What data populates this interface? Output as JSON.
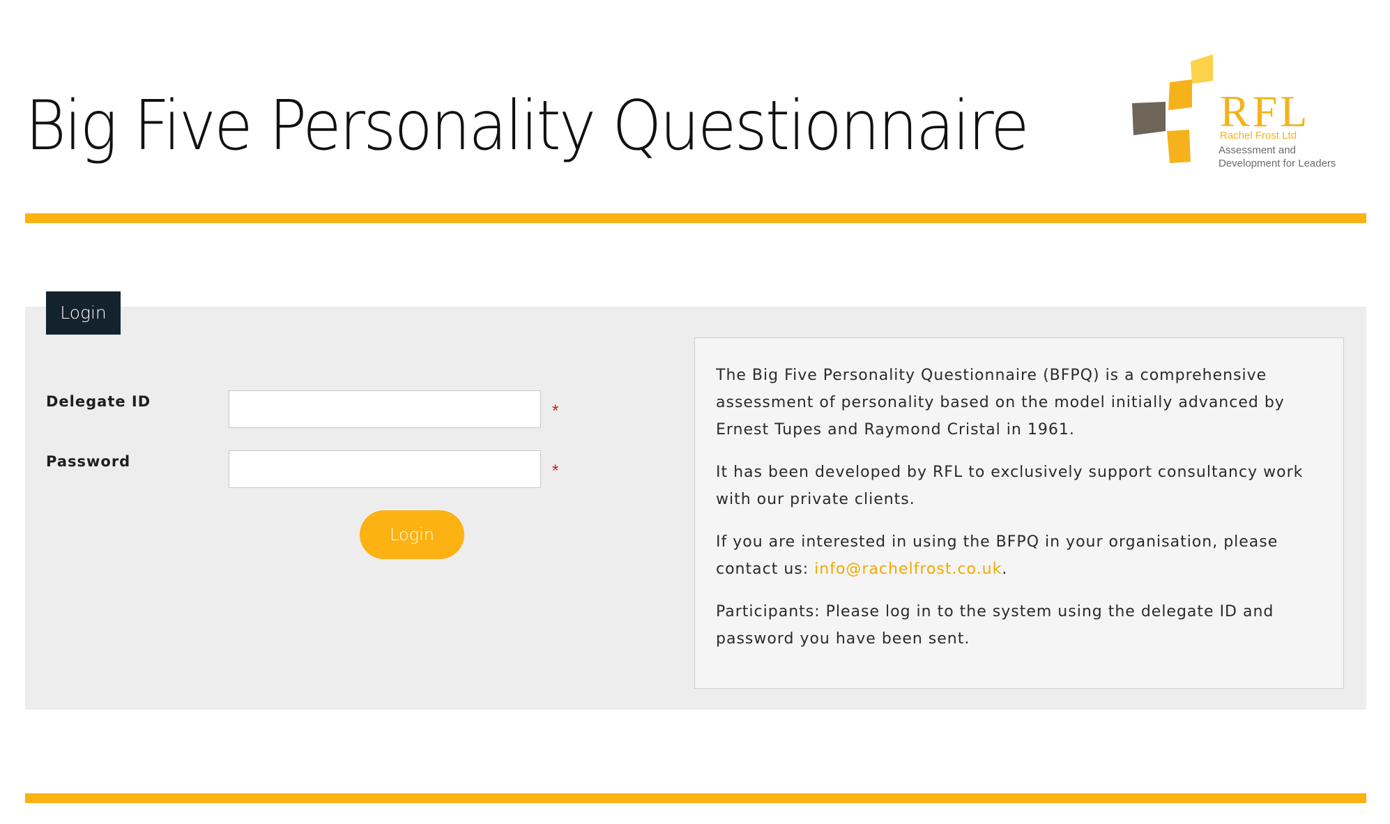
{
  "header": {
    "title": "Big Five Personality Questionnaire",
    "logo": {
      "mark": "RFL",
      "company": "Rachel Frost Ltd",
      "tagline": "Assessment and Development for Leaders"
    }
  },
  "login_panel": {
    "tab_label": "Login",
    "delegate_id": {
      "label": "Delegate ID",
      "value": "",
      "required_marker": "*"
    },
    "password": {
      "label": "Password",
      "value": "",
      "required_marker": "*"
    },
    "submit_label": "Login"
  },
  "info": {
    "p1": "The Big Five Personality Questionnaire (BFPQ) is a comprehensive assessment of personality based on the model initially advanced by Ernest Tupes and Raymond Cristal in 1961.",
    "p2": "It has been developed by RFL to exclusively support consultancy work with our private clients.",
    "p3_prefix": "If you are interested in using the BFPQ in your organisation, please contact us: ",
    "p3_email": "info@rachelfrost.co.uk",
    "p3_suffix": ".",
    "p4": "Participants: Please log in to the system using the delegate ID and password you have been sent."
  },
  "colors": {
    "accent": "#fbb212",
    "tab_bg": "#14222d",
    "panel_bg": "#ededed",
    "required": "#d21e1e"
  }
}
